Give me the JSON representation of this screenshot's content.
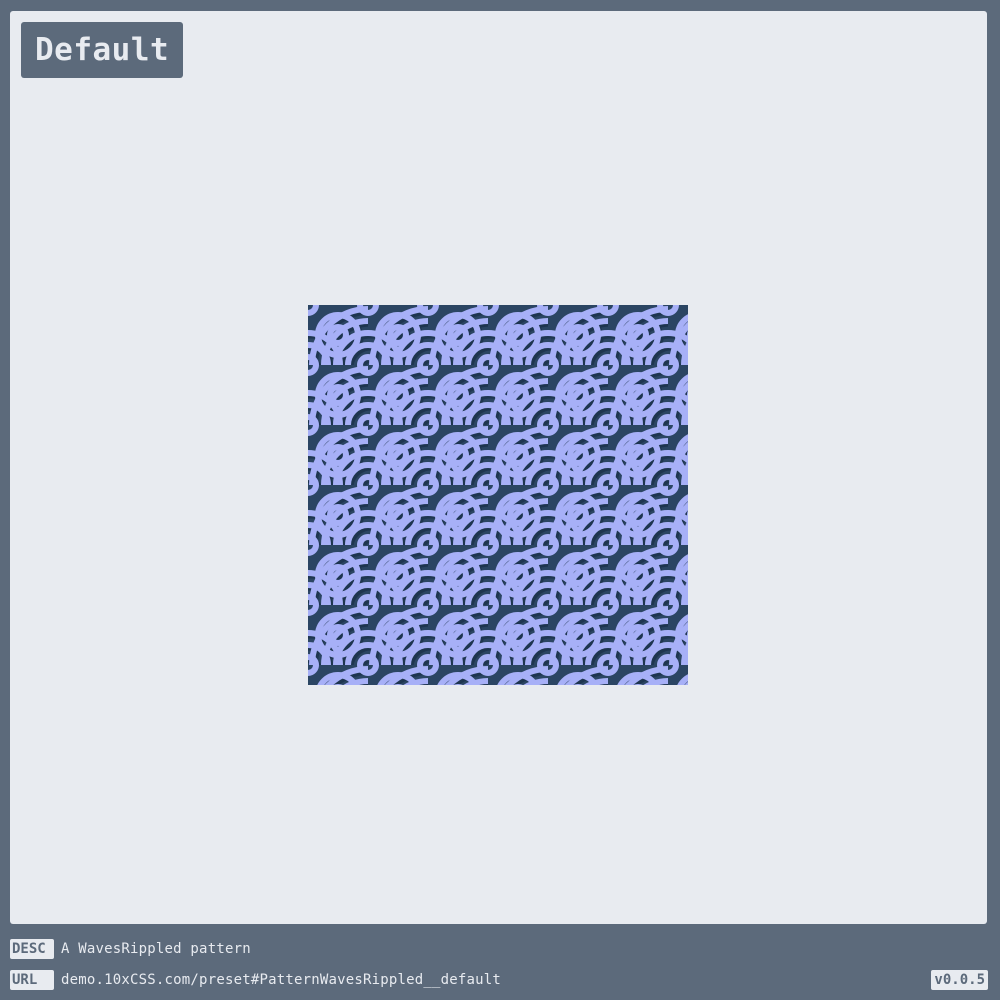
{
  "header": {
    "title": "Default"
  },
  "pattern": {
    "name": "WavesRippled",
    "colors": {
      "background": "#2a4a6b",
      "wave_light": "#a7b0f7",
      "wave_dark": "#2b4563",
      "shadow": "#1e3550"
    }
  },
  "footer": {
    "desc_tag": "DESC",
    "desc_text": "A WavesRippled pattern",
    "url_tag": "URL",
    "url_text": "demo.10xCSS.com/preset#PatternWavesRippled__default",
    "version": "v0.0.5"
  },
  "theme": {
    "frame": "#5c6a7b",
    "stage": "#e8ebf0"
  }
}
